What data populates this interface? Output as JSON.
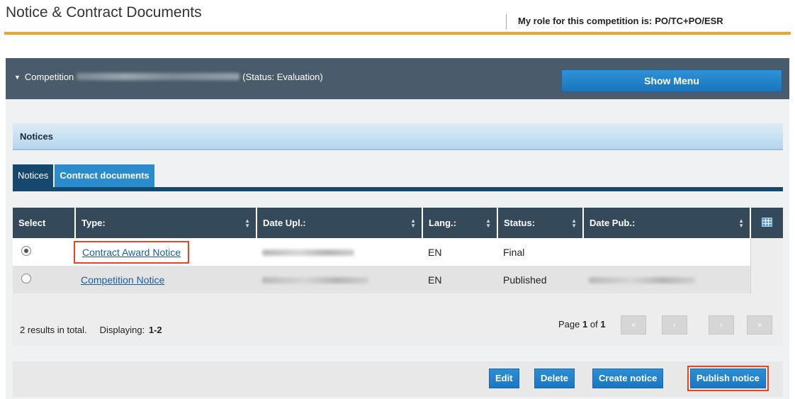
{
  "header": {
    "title": "Notice & Contract Documents",
    "role_label": "My role for this competition is:",
    "role_value": "PO/TC+PO/ESR"
  },
  "competition": {
    "label": "Competition",
    "status": "(Status: Evaluation)",
    "show_menu": "Show Menu"
  },
  "section": {
    "title": "Notices"
  },
  "tabs": [
    {
      "label": "Notices",
      "active": true
    },
    {
      "label": "Contract documents",
      "active": false
    }
  ],
  "table": {
    "columns": [
      "Select",
      "Type:",
      "Date Upl.:",
      "Lang.:",
      "Status:",
      "Date Pub.:"
    ],
    "rows": [
      {
        "selected": true,
        "type": "Contract Award Notice",
        "lang": "EN",
        "status": "Final"
      },
      {
        "selected": false,
        "type": "Competition Notice",
        "lang": "EN",
        "status": "Published"
      }
    ]
  },
  "summary": {
    "results": "2 results in total.",
    "displaying_label": "Displaying:",
    "displaying_value": "1-2"
  },
  "pager": {
    "page_label": "Page",
    "page": "1",
    "of_label": "of",
    "total": "1",
    "first": "«",
    "prev": "‹",
    "next": "›",
    "last": "»"
  },
  "actions": {
    "edit": "Edit",
    "delete": "Delete",
    "create": "Create notice",
    "publish": "Publish notice"
  },
  "colors": {
    "accent_orange": "#f5a21c",
    "header_dark": "#34495a",
    "button_blue": "#1b76c0",
    "highlight_red": "#e5461e"
  }
}
